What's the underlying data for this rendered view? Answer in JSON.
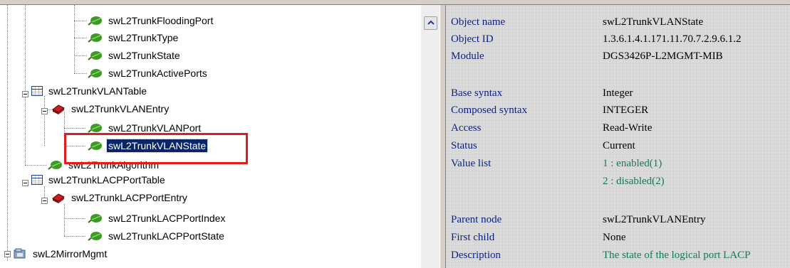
{
  "tree": {
    "nodes": [
      {
        "label": "swL2TrunkFloodingPort"
      },
      {
        "label": "swL2TrunkType"
      },
      {
        "label": "swL2TrunkState"
      },
      {
        "label": "swL2TrunkActivePorts"
      },
      {
        "label": "swL2TrunkVLANTable"
      },
      {
        "label": "swL2TrunkVLANEntry"
      },
      {
        "label": "swL2TrunkVLANPort"
      },
      {
        "label": "swL2TrunkVLANState"
      },
      {
        "label": "swL2TrunkAlgorithm"
      },
      {
        "label": "swL2TrunkLACPPortTable"
      },
      {
        "label": "swL2TrunkLACPPortEntry"
      },
      {
        "label": "swL2TrunkLACPPortIndex"
      },
      {
        "label": "swL2TrunkLACPPortState"
      },
      {
        "label": "swL2MirrorMgmt"
      }
    ],
    "selected": "swL2TrunkVLANState",
    "highlight_color": "#e41b1b"
  },
  "properties": {
    "object_name": {
      "key": "Object name",
      "value": "swL2TrunkVLANState"
    },
    "object_id": {
      "key": "Object ID",
      "value": "1.3.6.1.4.1.171.11.70.7.2.9.6.1.2"
    },
    "module": {
      "key": "Module",
      "value": "DGS3426P-L2MGMT-MIB"
    },
    "base_syntax": {
      "key": "Base syntax",
      "value": "Integer"
    },
    "composed_syntax": {
      "key": "Composed syntax",
      "value": "INTEGER"
    },
    "access": {
      "key": "Access",
      "value": "Read-Write"
    },
    "status": {
      "key": "Status",
      "value": "Current"
    },
    "value_list": {
      "key": "Value list",
      "values": [
        "1 : enabled(1)",
        "2 : disabled(2)"
      ]
    },
    "parent_node": {
      "key": "Parent node",
      "value": "swL2TrunkVLANEntry"
    },
    "first_child": {
      "key": "First child",
      "value": "None"
    },
    "description": {
      "key": "Description",
      "value": "The state of the logical port LACP"
    }
  },
  "colors": {
    "key_text": "#0a1f8f",
    "value_list_text": "#127a5a",
    "pane_bg": "#c6c6c6"
  }
}
